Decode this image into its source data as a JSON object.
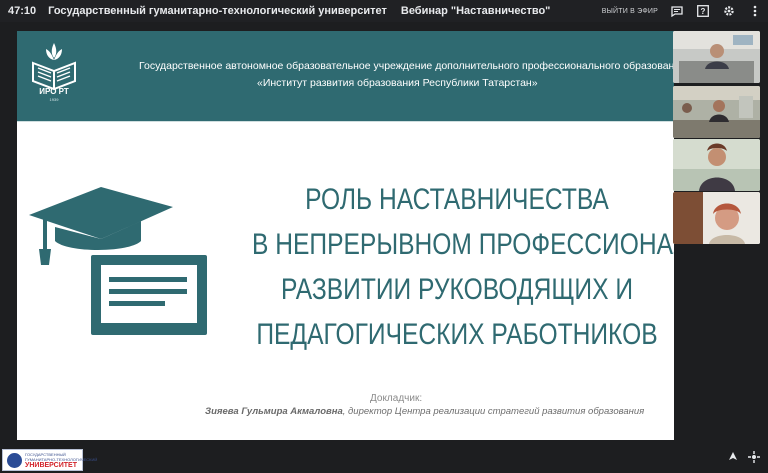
{
  "topbar": {
    "timer": "47:10",
    "title": "Государственный гуманитарно-технологический университет",
    "webinar": "Вебинар \"Наставничество\"",
    "onair": "ВЫЙТИ В ЭФИР",
    "icons": [
      "chat-icon",
      "help-icon",
      "settings-icon",
      "more-icon"
    ]
  },
  "slide": {
    "logo_text": "ИРО РТ",
    "logo_year": "1939",
    "org_line1": "Государственное автономное образовательное учреждение дополнительного профессионального образования",
    "org_line2": "«Институт развития образования Республики Татарстан»",
    "title_lines": [
      "РОЛЬ НАСТАВНИЧЕСТВА",
      "В НЕПРЕРЫВНОМ ПРОФЕССИОНАЛЬНОМ",
      "РАЗВИТИИ РУКОВОДЯЩИХ И",
      "ПЕДАГОГИЧЕСКИХ РАБОТНИКОВ"
    ],
    "speaker_label": "Докладчик:",
    "speaker_name": "Зияева Гульмира Акмаловна",
    "speaker_role": ", директор Центра реализации стратегий развития образования"
  },
  "footer": {
    "logo_l1": "ГОСУДАРСТВЕННЫЙ",
    "logo_l2": "ГУМАНИТАРНО-ТЕХНОЛОГИЧЕСКИЙ",
    "logo_l3": "УНИВЕРСИТЕТ"
  },
  "colors": {
    "brand": "#2f6a71",
    "topbar": "#202124",
    "background": "#1d1e20"
  }
}
